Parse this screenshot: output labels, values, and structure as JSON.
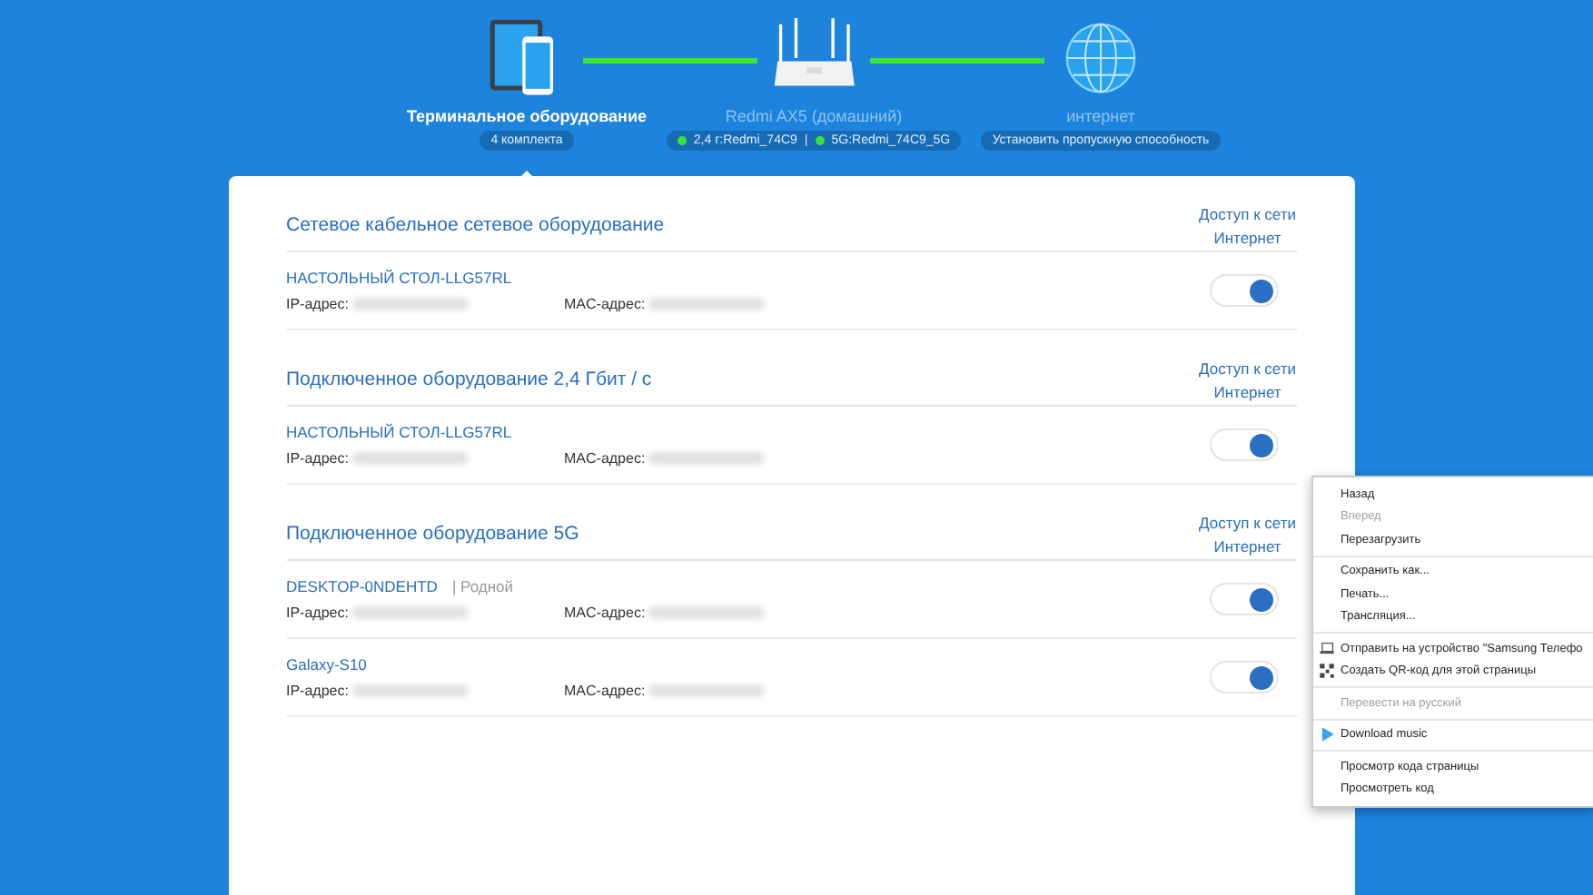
{
  "topology": {
    "devices": {
      "title": "Терминальное оборудование",
      "badge": "4 комплекта",
      "selected": true
    },
    "router": {
      "title": "Redmi AX5 (домашний)",
      "separator": "|",
      "bands": [
        {
          "label": "2,4 г:Redmi_74C9",
          "on": true
        },
        {
          "label": "5G:Redmi_74C9_5G",
          "on": true
        }
      ]
    },
    "internet": {
      "title": "интернет",
      "badge": "Установить пропускную способность"
    }
  },
  "sections": [
    {
      "title": "Сетевое кабельное сетевое оборудование",
      "column_head": [
        "Доступ к сети",
        "Интернет"
      ],
      "devices": [
        {
          "name": "НАСТОЛЬНЫЙ СТОЛ-LLG57RL",
          "ip_label": "IP-адрес:",
          "mac_label": "MAC-адрес:",
          "internet": true
        }
      ]
    },
    {
      "title": "Подключенное оборудование 2,4 Гбит / с",
      "column_head": [
        "Доступ к сети",
        "Интернет"
      ],
      "devices": [
        {
          "name": "НАСТОЛЬНЫЙ СТОЛ-LLG57RL",
          "ip_label": "IP-адрес:",
          "mac_label": "MAC-адрес:",
          "internet": true
        }
      ]
    },
    {
      "title": "Подключенное оборудование 5G",
      "column_head": [
        "Доступ к сети",
        "Интернет"
      ],
      "devices": [
        {
          "name": "DESKTOP-0NDEHTD",
          "tag": "| Родной",
          "ip_label": "IP-адрес:",
          "mac_label": "MAC-адрес:",
          "internet": true
        },
        {
          "name": "Galaxy-S10",
          "ip_label": "IP-адрес:",
          "mac_label": "MAC-адрес:",
          "internet": true
        }
      ]
    }
  ],
  "context_menu": {
    "groups": [
      [
        {
          "label": "Назад",
          "disabled": false
        },
        {
          "label": "Вперед",
          "disabled": true
        },
        {
          "label": "Перезагрузить",
          "disabled": false
        }
      ],
      [
        {
          "label": "Сохранить как...",
          "disabled": false
        },
        {
          "label": "Печать...",
          "disabled": false
        },
        {
          "label": "Трансляция...",
          "disabled": false
        }
      ],
      [
        {
          "label": "Отправить на устройство \"Samsung Телефо",
          "disabled": false,
          "kind": "device"
        },
        {
          "label": "Создать QR-код для этой страницы",
          "disabled": false,
          "kind": "qr"
        }
      ],
      [
        {
          "label": "Перевести на русский",
          "disabled": true
        }
      ],
      [
        {
          "label": "Download music",
          "disabled": false,
          "kind": "play"
        }
      ],
      [
        {
          "label": "Просмотр кода страницы",
          "disabled": false
        },
        {
          "label": "Просмотреть код",
          "disabled": false
        }
      ]
    ]
  }
}
